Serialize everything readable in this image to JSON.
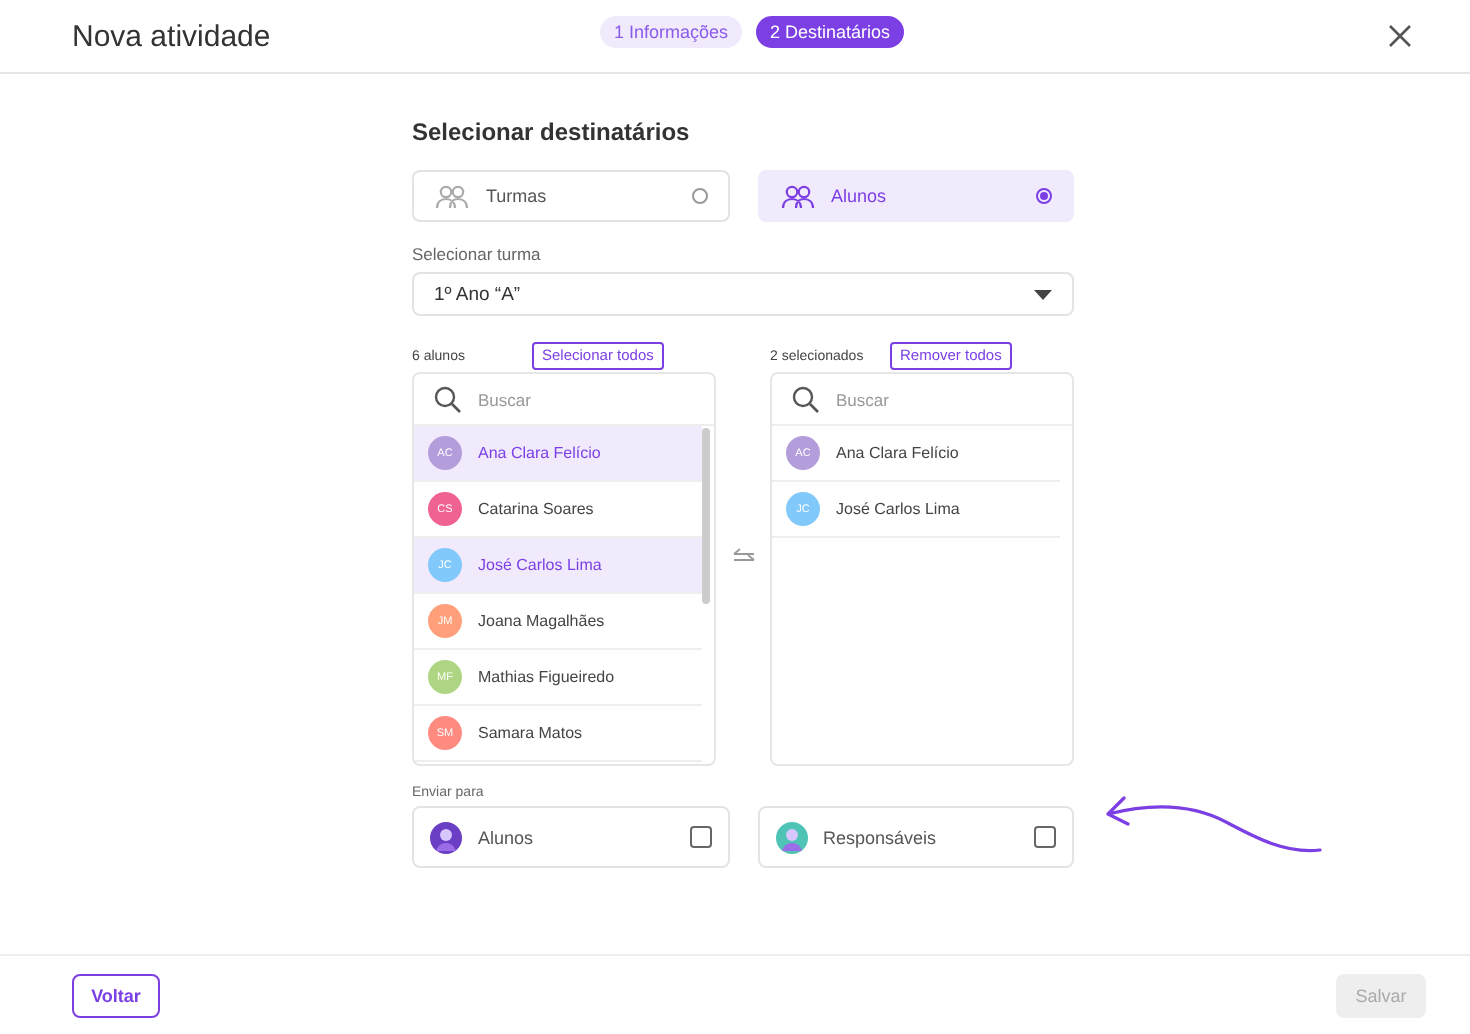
{
  "header": {
    "title": "Nova atividade",
    "steps": [
      {
        "number": "1",
        "label": "Informações",
        "selected": false
      },
      {
        "number": "2",
        "label": "Destinatários",
        "selected": true
      }
    ]
  },
  "section_title": "Selecionar destinatários",
  "target_options": [
    {
      "label": "Turmas",
      "selected": false
    },
    {
      "label": "Alunos",
      "selected": true
    }
  ],
  "class_select": {
    "label": "Selecionar turma",
    "value": "1º Ano “A”"
  },
  "available": {
    "count": "6 alunos",
    "action": "Selecionar todos",
    "search_placeholder": "Buscar",
    "students": [
      {
        "initials": "AC",
        "name": "Ana Clara Felício",
        "color": "#b39ddb",
        "selected": true
      },
      {
        "initials": "CS",
        "name": "Catarina Soares",
        "color": "#f06292",
        "selected": false
      },
      {
        "initials": "JC",
        "name": "José Carlos Lima",
        "color": "#81c9fa",
        "selected": true
      },
      {
        "initials": "JM",
        "name": "Joana Magalhães",
        "color": "#ffa07a",
        "selected": false
      },
      {
        "initials": "MF",
        "name": "Mathias Figueiredo",
        "color": "#aed581",
        "selected": false
      },
      {
        "initials": "SM",
        "name": "Samara Matos",
        "color": "#ff8a80",
        "selected": false
      }
    ]
  },
  "chosen": {
    "count": "2 selecionados",
    "action": "Remover todos",
    "search_placeholder": "Buscar",
    "students": [
      {
        "initials": "AC",
        "name": "Ana Clara Felício",
        "color": "#b39ddb"
      },
      {
        "initials": "JC",
        "name": "José Carlos Lima",
        "color": "#81c9fa"
      }
    ]
  },
  "send_to": {
    "label": "Enviar para",
    "options": [
      {
        "label": "Alunos",
        "checked": false
      },
      {
        "label": "Responsáveis",
        "checked": false
      }
    ]
  },
  "footer": {
    "back": "Voltar",
    "save": "Salvar",
    "save_disabled": true
  }
}
